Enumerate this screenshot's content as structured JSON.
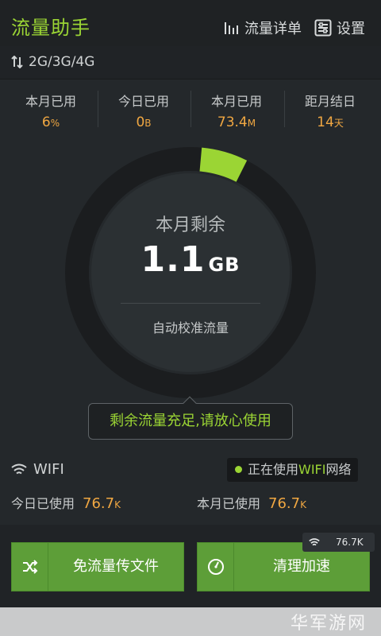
{
  "header": {
    "title": "流量助手",
    "detail_label": "流量详单",
    "settings_label": "设置"
  },
  "network": {
    "label": "2G/3G/4G"
  },
  "stats": [
    {
      "label": "本月已用",
      "value": "6",
      "unit": "%"
    },
    {
      "label": "今日已用",
      "value": "0",
      "unit": "B"
    },
    {
      "label": "本月已用",
      "value": "73.4",
      "unit": "M"
    },
    {
      "label": "距月结日",
      "value": "14",
      "unit": "天"
    }
  ],
  "gauge": {
    "used_fraction": 0.06,
    "remain_label": "本月剩余",
    "remain_value": "1.1",
    "remain_unit": "GB",
    "calibrate_label": "自动校准流量",
    "colors": {
      "track": "#1b1d1f",
      "fill": "#9bd534",
      "inner": "#2b3033"
    }
  },
  "tip": {
    "text": "剩余流量充足,请放心使用"
  },
  "wifi": {
    "label": "WIFI",
    "status_prefix": "正在使用",
    "status_highlight": "WIFI",
    "status_suffix": "网络",
    "today_label": "今日已使用",
    "today_value": "76.7",
    "today_unit": "K",
    "month_label": "本月已使用",
    "month_value": "76.7",
    "month_unit": "K"
  },
  "actions": {
    "free_transfer": "免流量传文件",
    "clean_speed": "清理加速"
  },
  "float_speed": {
    "value": "76.7K"
  },
  "watermark": {
    "text": "华军游网"
  },
  "colors": {
    "accent": "#9bd534",
    "value": "#f0a742",
    "button": "#5d9e38",
    "background": "#24282b"
  }
}
